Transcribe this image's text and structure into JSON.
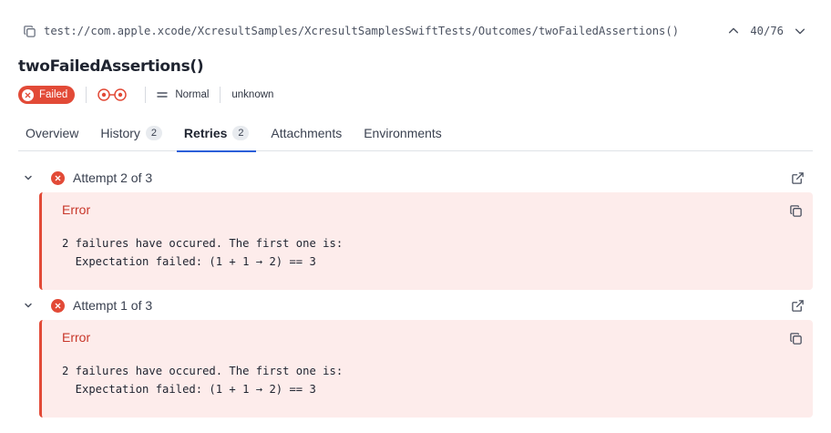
{
  "header": {
    "path": "test://com.apple.xcode/XcresultSamples/XcresultSamplesSwiftTests/Outcomes/twoFailedAssertions()",
    "position": "40/76",
    "icons": {
      "copy": "copy-icon",
      "prev": "chevron-up-icon",
      "next": "chevron-down-icon"
    }
  },
  "test": {
    "title": "twoFailedAssertions()",
    "status": "Failed",
    "severity": "Normal",
    "owner": "unknown",
    "icons": {
      "status": "close-icon",
      "flaky": "retry-flow-icon",
      "severity": "equals-icon"
    }
  },
  "tabs": [
    {
      "label": "Overview",
      "count": null,
      "active": false
    },
    {
      "label": "History",
      "count": "2",
      "active": false
    },
    {
      "label": "Retries",
      "count": "2",
      "active": true
    },
    {
      "label": "Attachments",
      "count": null,
      "active": false
    },
    {
      "label": "Environments",
      "count": null,
      "active": false
    }
  ],
  "attempts": [
    {
      "label": "Attempt 2 of 3",
      "error_title": "Error",
      "error_message": "2 failures have occured. The first one is:\n  Expectation failed: (1 + 1 → 2) == 3"
    },
    {
      "label": "Attempt 1 of 3",
      "error_title": "Error",
      "error_message": "2 failures have occured. The first one is:\n  Expectation failed: (1 + 1 → 2) == 3"
    }
  ],
  "colors": {
    "failed": "#e24a37",
    "error_background": "#fdeceb",
    "error_text": "#c8372a",
    "active_tab": "#2b5fd9"
  }
}
